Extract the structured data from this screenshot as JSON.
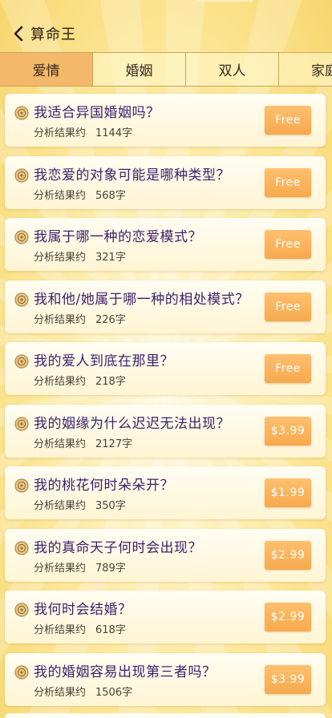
{
  "header": {
    "title": "算命王",
    "back_icon": "chevron-left-icon"
  },
  "tabs": [
    {
      "label": "爱情",
      "active": true
    },
    {
      "label": "婚姻",
      "active": false
    },
    {
      "label": "双人",
      "active": false
    },
    {
      "label": "家庭",
      "active": false
    }
  ],
  "items": [
    {
      "title": "我适合异国婚姻吗？",
      "meta_label": "分析结果约",
      "length": "1144字",
      "price": "Free"
    },
    {
      "title": "我恋爱的对象可能是哪种类型？",
      "meta_label": "分析结果约",
      "length": "568字",
      "price": "Free"
    },
    {
      "title": "我属于哪一种的恋爱模式？",
      "meta_label": "分析结果约",
      "length": "321字",
      "price": "Free"
    },
    {
      "title": "我和他/她属于哪一种的相处模式？",
      "meta_label": "分析结果约",
      "length": "226字",
      "price": "Free"
    },
    {
      "title": "我的爱人到底在那里？",
      "meta_label": "分析结果约",
      "length": "218字",
      "price": "Free"
    },
    {
      "title": "我的姻缘为什么迟迟无法出现？",
      "meta_label": "分析结果约",
      "length": "2127字",
      "price": "$3.99"
    },
    {
      "title": "我的桃花何时朵朵开？",
      "meta_label": "分析结果约",
      "length": "350字",
      "price": "$1.99"
    },
    {
      "title": "我的真命天子何时会出现？",
      "meta_label": "分析结果约",
      "length": "789字",
      "price": "$2.99"
    },
    {
      "title": "我何时会结婚？",
      "meta_label": "分析结果约",
      "length": "618字",
      "price": "$2.99"
    },
    {
      "title": "我的婚姻容易出现第三者吗？",
      "meta_label": "分析结果约",
      "length": "1506字",
      "price": "$3.99"
    }
  ],
  "colors": {
    "title_purple": "#3d1f6b",
    "button_orange": "#f7a94d",
    "tab_active": "#f4b86a"
  }
}
